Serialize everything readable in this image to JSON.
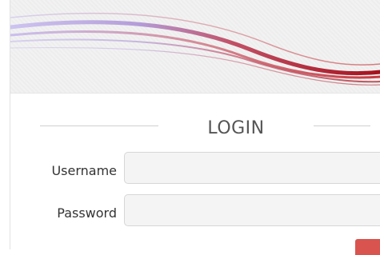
{
  "login": {
    "title": "LOGIN",
    "username_label": "Username",
    "username_value": "",
    "password_label": "Password",
    "password_value": ""
  },
  "colors": {
    "banner_bg": "#f2f2f2",
    "swoosh_purple": "#9b88d6",
    "swoosh_red": "#b0121b",
    "input_bg": "#f4f4f4",
    "submit_button": "#d9534f"
  }
}
